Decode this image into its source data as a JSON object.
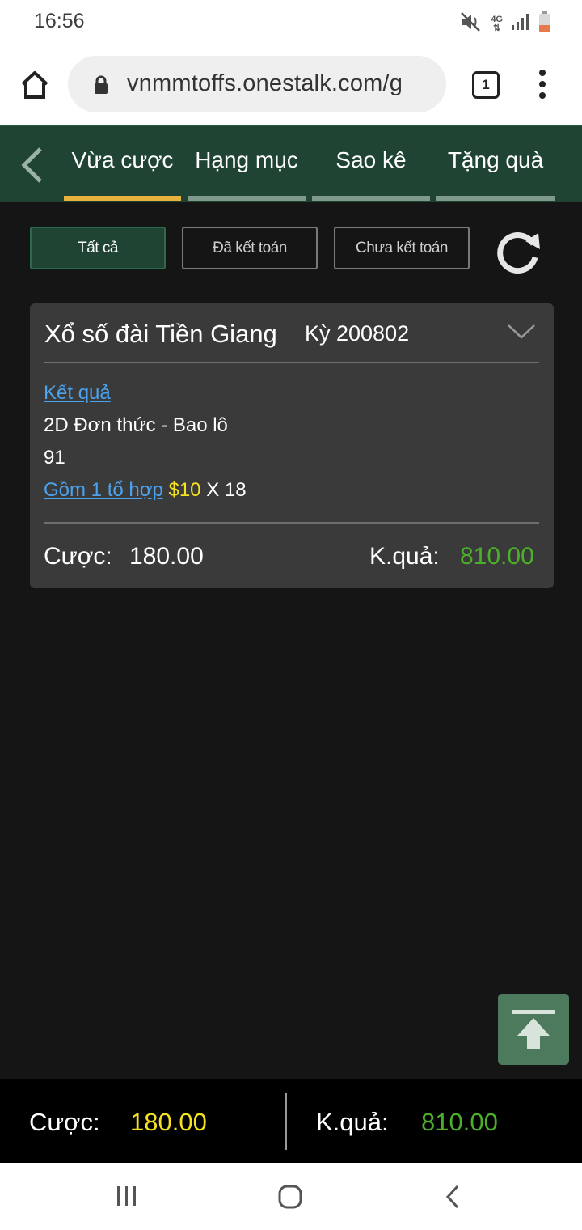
{
  "status_bar": {
    "time": "16:56",
    "icons": [
      "mute-icon",
      "4g-icon",
      "signal-icon",
      "battery-icon"
    ],
    "network_label": "4G"
  },
  "browser": {
    "url": "vnmmtoffs.onestalk.com/g",
    "tab_count": "1"
  },
  "nav": {
    "tabs": [
      {
        "label": "Vừa cược",
        "active": true
      },
      {
        "label": "Hạng mục",
        "active": false
      },
      {
        "label": "Sao kê",
        "active": false
      },
      {
        "label": "Tặng quà",
        "active": false
      }
    ]
  },
  "filters": [
    {
      "label": "Tất cả",
      "active": true
    },
    {
      "label": "Đã kết toán",
      "active": false
    },
    {
      "label": "Chưa kết toán",
      "active": false
    }
  ],
  "bet_card": {
    "title": "Xổ số đài Tiền Giang",
    "period": "Kỳ 200802",
    "result_link": "Kết quả",
    "bet_type": "2D Đơn thức - Bao lô",
    "number": "91",
    "combo_label": "Gồm 1 tổ hợp",
    "combo_amount": "$10",
    "combo_multiplier": "X 18",
    "stake_label": "Cược:",
    "stake_value": "180.00",
    "result_label": "K.quả:",
    "result_value": "810.00"
  },
  "footer": {
    "stake_label": "Cược:",
    "stake_value": "180.00",
    "result_label": "K.quả:",
    "result_value": "810.00"
  },
  "colors": {
    "nav_green": "#1f4433",
    "active_underline": "#e8b23e",
    "link_blue": "#4ba3f0",
    "money_yellow": "#f4e11f",
    "win_green": "#4caf2a"
  }
}
